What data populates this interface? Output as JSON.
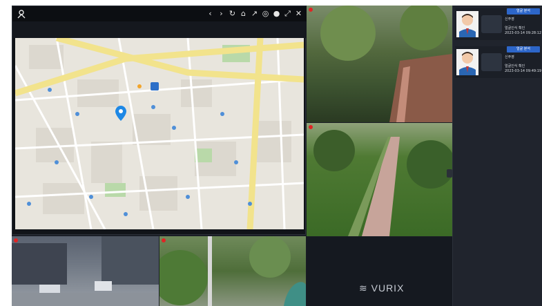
{
  "toolbar": {
    "left_icon": "map-pin-person-icon",
    "right_icons": [
      "chevron-left-icon",
      "chevron-right-icon",
      "refresh-icon",
      "home-icon",
      "measure-icon",
      "target-icon",
      "globe-icon",
      "fullscreen-icon",
      "close-icon"
    ]
  },
  "map": {
    "pin_color": "#1e88e5",
    "park_color": "#8ac27b",
    "road_color": "#f0e08a"
  },
  "cameras": [
    {
      "name": "cam-1"
    },
    {
      "name": "cam-2"
    },
    {
      "name": "cam-3"
    },
    {
      "name": "cam-4"
    }
  ],
  "logo": {
    "text": "VURIX"
  },
  "events": [
    {
      "badge": "얼굴 분석",
      "name": "신주영",
      "detail": "얼굴인식 확인",
      "time": "2023-03-14 09:28:12"
    },
    {
      "badge": "얼굴 분석",
      "name": "신주영",
      "detail": "얼굴인식 확인",
      "time": "2023-03-14 09:49:19"
    }
  ]
}
